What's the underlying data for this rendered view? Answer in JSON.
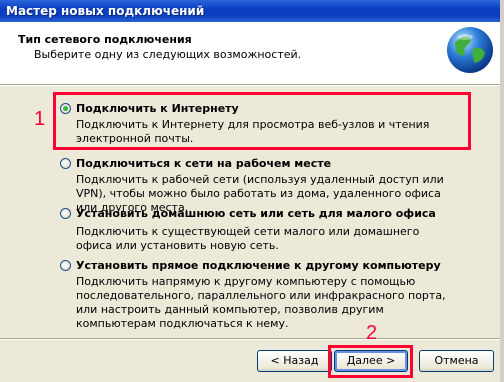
{
  "window": {
    "title": "Мастер новых подключений"
  },
  "header": {
    "title": "Тип сетевого подключения",
    "subtitle": "Выберите одну из следующих возможностей."
  },
  "options": [
    {
      "label": "Подключить к Интернету",
      "description": "Подключить к Интернету для просмотра веб-узлов и чтения электронной почты.",
      "selected": true
    },
    {
      "label": "Подключиться к сети на рабочем месте",
      "description": "Подключить к рабочей сети (используя удаленный доступ или VPN), чтобы можно было работать из дома, удаленного офиса или другого места.",
      "selected": false
    },
    {
      "label": "Установить домашнюю сеть или сеть для малого офиса",
      "description": "Подключить к существующей сети малого или домашнего офиса или установить новую сеть.",
      "selected": false
    },
    {
      "label": "Установить прямое подключение к другому компьютеру",
      "description": "Подключить напрямую к другому компьютеру с помощью последовательного, параллельного или инфракрасного порта, или настроить данный компьютер, позволив другим компьютерам подключаться к нему.",
      "selected": false
    }
  ],
  "annotations": {
    "marker1": "1",
    "marker2": "2",
    "highlight_color": "#ff0033"
  },
  "buttons": {
    "back": "< Назад",
    "next": "Далее >",
    "cancel": "Отмена"
  },
  "icons": {
    "header_icon": "globe-icon"
  }
}
